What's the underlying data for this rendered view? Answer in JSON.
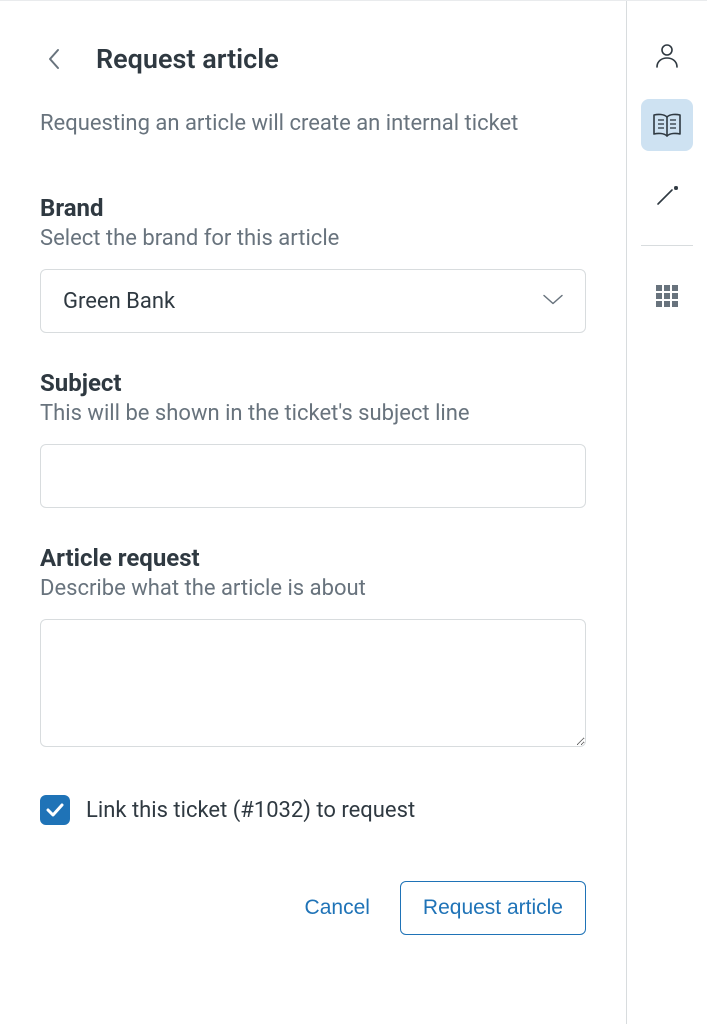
{
  "header": {
    "title": "Request article"
  },
  "intro": "Requesting an article will create an internal ticket",
  "fields": {
    "brand": {
      "label": "Brand",
      "help": "Select the brand for this article",
      "selected": "Green Bank"
    },
    "subject": {
      "label": "Subject",
      "help": "This will be shown in the ticket's subject line",
      "value": ""
    },
    "article_request": {
      "label": "Article request",
      "help": "Describe what the article is about",
      "value": ""
    }
  },
  "link_checkbox": {
    "checked": true,
    "label": "Link this ticket (#1032) to request"
  },
  "actions": {
    "cancel": "Cancel",
    "submit": "Request article"
  },
  "side_rail": {
    "items": [
      "profile",
      "knowledge",
      "magic",
      "apps"
    ],
    "active": "knowledge"
  }
}
